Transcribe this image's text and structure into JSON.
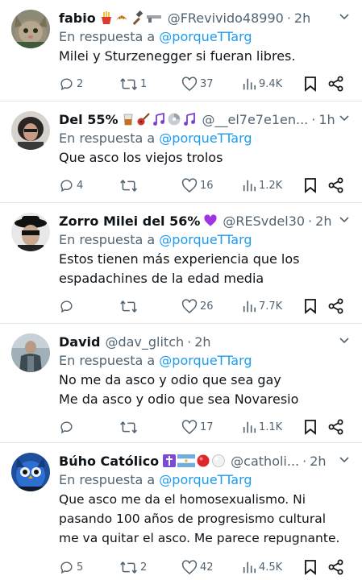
{
  "posts": [
    {
      "name": "fabio",
      "emojis": [
        "fries",
        "croissant",
        "hammer",
        "gun"
      ],
      "handle": "@FRevivido48990",
      "time": "2h",
      "reply_prefix": "En respuesta a ",
      "reply_to": "@porqueTTarg",
      "lines": [
        "Milei y Sturzenegger si fueran libres."
      ],
      "replies": "2",
      "retweets": "1",
      "likes": "37",
      "views": "9.4K"
    },
    {
      "name": "Del 55%",
      "emojis": [
        "whisky",
        "guitar",
        "notes",
        "cd",
        "notes"
      ],
      "handle": "@__el7e7e1en...",
      "time": "1h",
      "reply_prefix": "En respuesta a ",
      "reply_to": "@porqueTTarg",
      "lines": [
        "Que asco los viejos trolos"
      ],
      "replies": "4",
      "retweets": "",
      "likes": "16",
      "views": "1.2K"
    },
    {
      "name": "Zorro Milei del 56%",
      "emojis": [
        "purple-heart"
      ],
      "handle": "@RESvdel30",
      "time": "2h",
      "reply_prefix": "En respuesta a ",
      "reply_to": "@porqueTTarg",
      "lines": [
        "Estos tienen más experiencia que los",
        "espadachines de la edad media"
      ],
      "replies": "",
      "retweets": "",
      "likes": "26",
      "views": "7.7K"
    },
    {
      "name": "David",
      "emojis": [],
      "handle": "@dav_glitch",
      "time": "2h",
      "reply_prefix": "En respuesta a ",
      "reply_to": "@porqueTTarg",
      "lines": [
        "No me da asco y odio que sea gay",
        "Me da asco y odio que sea Novaresio"
      ],
      "replies": "",
      "retweets": "",
      "likes": "17",
      "views": "1.1K"
    },
    {
      "name": "Búho Católico",
      "emojis": [
        "cross",
        "argentina-flag",
        "red-ball",
        "white-ball"
      ],
      "handle": "@catholi...",
      "time": "2h",
      "reply_prefix": "En respuesta a ",
      "reply_to": "@porqueTTarg",
      "lines": [
        "Que asco me da el homosexualismo. Ni",
        "pasando 100 años de progresismo cultural",
        "me va quitar el asco. Me parece repugnante."
      ],
      "replies": "5",
      "retweets": "2",
      "likes": "42",
      "views": "4.5K"
    }
  ],
  "colors": {
    "text": "#0f1419",
    "muted": "#536471",
    "link": "#1d9bf0",
    "divider": "#e3e6e8"
  }
}
